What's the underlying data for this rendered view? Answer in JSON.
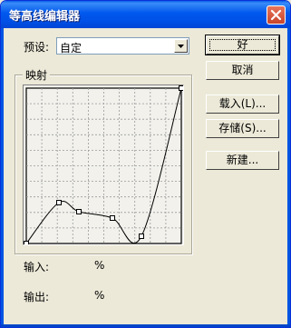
{
  "window": {
    "title": "等高线编辑器"
  },
  "preset": {
    "label": "预设:",
    "value": "自定"
  },
  "group": {
    "label": "映射"
  },
  "curve": {
    "points": [
      [
        0,
        0
      ],
      [
        36,
        45
      ],
      [
        58,
        35
      ],
      [
        95,
        28
      ],
      [
        127,
        8
      ],
      [
        171,
        171
      ]
    ]
  },
  "buttons": {
    "ok": "好",
    "cancel": "取消",
    "load": "载入(L)...",
    "save": "存储(S)...",
    "new": "新建..."
  },
  "fields": {
    "input_label": "输入:",
    "input_value": "%",
    "output_label": "输出:",
    "output_value": "%"
  },
  "colors": {
    "titlebar": "#0054e3",
    "face": "#ece9d8",
    "grid_bg": "#f2f1ec",
    "grid_line": "#9a9a9a",
    "close": "#c7452a"
  },
  "icons": [
    "close-icon",
    "chevron-down-icon",
    "curve-point-icon"
  ]
}
